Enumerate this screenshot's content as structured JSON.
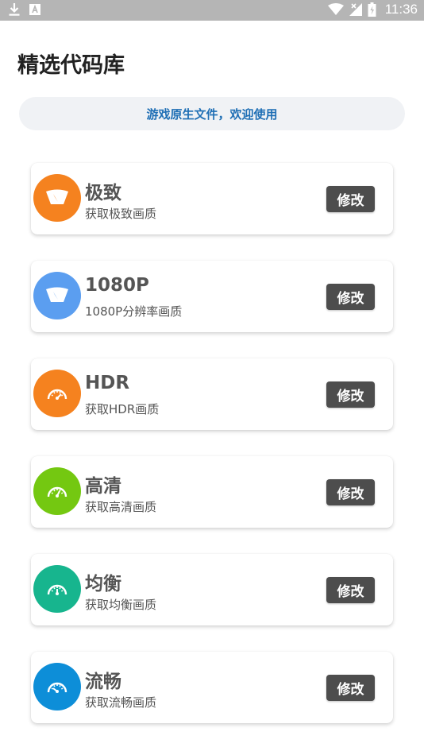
{
  "status_bar": {
    "time": "11:36",
    "left_icons": [
      "download-icon",
      "a-icon"
    ],
    "right_icons": [
      "wifi-icon",
      "signal-icon",
      "battery-icon"
    ]
  },
  "page": {
    "title": "精选代码库",
    "banner": "游戏原生文件，欢迎使用"
  },
  "cards": [
    {
      "title": "极致",
      "subtitle": "获取极致画质",
      "button": "修改",
      "icon": "lightning-icon",
      "color": "#f5821f"
    },
    {
      "title": "1080P",
      "subtitle": "1080P分辨率画质",
      "button": "修改",
      "icon": "lightning-icon",
      "color": "#5b9ef0"
    },
    {
      "title": "HDR",
      "subtitle": "获取HDR画质",
      "button": "修改",
      "icon": "gauge-icon",
      "color": "#f5821f"
    },
    {
      "title": "高清",
      "subtitle": "获取高清画质",
      "button": "修改",
      "icon": "gauge-icon",
      "color": "#74c811"
    },
    {
      "title": "均衡",
      "subtitle": "获取均衡画质",
      "button": "修改",
      "icon": "gauge-icon",
      "color": "#17b58e"
    },
    {
      "title": "流畅",
      "subtitle": "获取流畅画质",
      "button": "修改",
      "icon": "gauge-icon",
      "color": "#0d8ed8"
    }
  ]
}
